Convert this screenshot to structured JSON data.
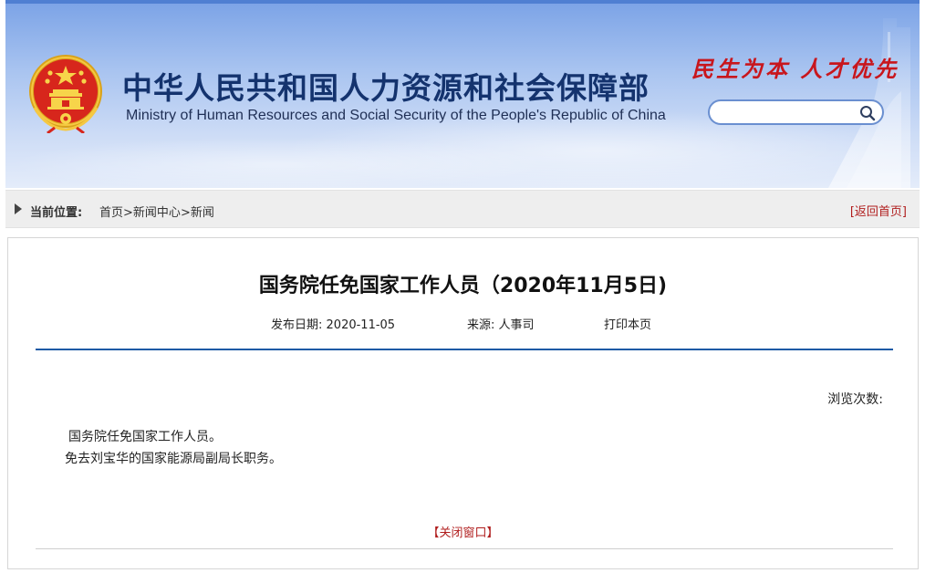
{
  "header": {
    "title_cn": "中华人民共和国人力资源和社会保障部",
    "title_en": "Ministry of Human Resources and Social Security of the People's Republic of China",
    "slogan": "民生为本 人才优先",
    "search": {
      "value": "",
      "placeholder": ""
    }
  },
  "breadcrumb": {
    "label": "当前位置:",
    "items": [
      "首页",
      "新闻中心",
      "新闻"
    ],
    "separator": ">",
    "back_home": "[返回首页]"
  },
  "article": {
    "title": "国务院任免国家工作人员（2020年11月5日)",
    "date_label": "发布日期:",
    "date_value": "2020-11-05",
    "source_label": "来源:",
    "source_value": "人事司",
    "print_label": "打印本页",
    "views_label": "浏览次数:",
    "paragraphs": [
      "国务院任免国家工作人员。",
      "免去刘宝华的国家能源局副局长职务。"
    ],
    "close_label": "【关闭窗口】"
  },
  "colors": {
    "accent_red": "#b01d1d",
    "title_blue": "#14336e",
    "rule_blue": "#1e5aa5"
  }
}
